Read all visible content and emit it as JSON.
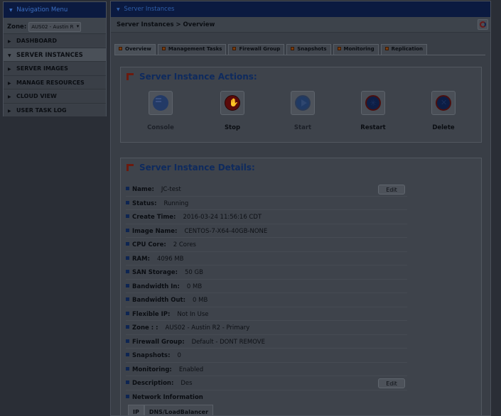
{
  "nav": {
    "header": "Navigation Menu",
    "zone_label": "Zone:",
    "zone_value": "AUS02 - Austin R",
    "items": [
      {
        "label": "DASHBOARD",
        "active": false
      },
      {
        "label": "SERVER INSTANCES",
        "active": true
      },
      {
        "label": "SERVER IMAGES",
        "active": false
      },
      {
        "label": "MANAGE RESOURCES",
        "active": false
      },
      {
        "label": "CLOUD VIEW",
        "active": false
      },
      {
        "label": "USER TASK LOG",
        "active": false
      }
    ]
  },
  "main": {
    "header": "Server Instances",
    "breadcrumb": "Server Instances >  Overview",
    "tabs": [
      "Overview",
      "Management Tasks",
      "Firewall Group",
      "Snapshots",
      "Monitoring",
      "Replication"
    ],
    "active_tab": "Overview"
  },
  "actions": {
    "title": "Server Instance Actions:",
    "buttons": [
      {
        "label": "Console",
        "icon": "console-icon",
        "enabled": false
      },
      {
        "label": "Stop",
        "icon": "stop-hand-icon",
        "enabled": true
      },
      {
        "label": "Start",
        "icon": "play-icon",
        "enabled": false
      },
      {
        "label": "Restart",
        "icon": "restart-icon",
        "enabled": true
      },
      {
        "label": "Delete",
        "icon": "delete-icon",
        "enabled": true
      }
    ]
  },
  "details": {
    "title": "Server Instance Details:",
    "edit_label": "Edit",
    "rows": [
      {
        "key": "Name:",
        "value": "JC-test",
        "editable": true
      },
      {
        "key": "Status:",
        "value": "Running"
      },
      {
        "key": "Create Time:",
        "value": "2016-03-24 11:56:16 CDT"
      },
      {
        "key": "Image Name:",
        "value": "CENTOS-7-X64-40GB-NONE"
      },
      {
        "key": "CPU Core:",
        "value": "2 Cores"
      },
      {
        "key": "RAM:",
        "value": "4096 MB"
      },
      {
        "key": "SAN Storage:",
        "value": "50 GB"
      },
      {
        "key": "Bandwidth In:",
        "value": "0 MB"
      },
      {
        "key": "Bandwidth Out:",
        "value": "0 MB"
      },
      {
        "key": "Flexible IP:",
        "value": "Not In Use"
      },
      {
        "key": "Zone : :",
        "value": "AUS02 - Austin R2 - Primary"
      },
      {
        "key": "Firewall Group:",
        "value": "Default - DONT REMOVE"
      },
      {
        "key": "Snapshots:",
        "value": "0"
      },
      {
        "key": "Monitoring:",
        "value": "Enabled"
      },
      {
        "key": "Description:",
        "value": "Des",
        "editable": true
      },
      {
        "key": "Network Information",
        "value": ""
      }
    ],
    "network_tabs": [
      "IP",
      "DNS/LoadBalancer"
    ]
  },
  "colors": {
    "header_bg": "#0b1a40",
    "title_blue": "#0e2a5e",
    "panel_bg": "#393e46"
  }
}
